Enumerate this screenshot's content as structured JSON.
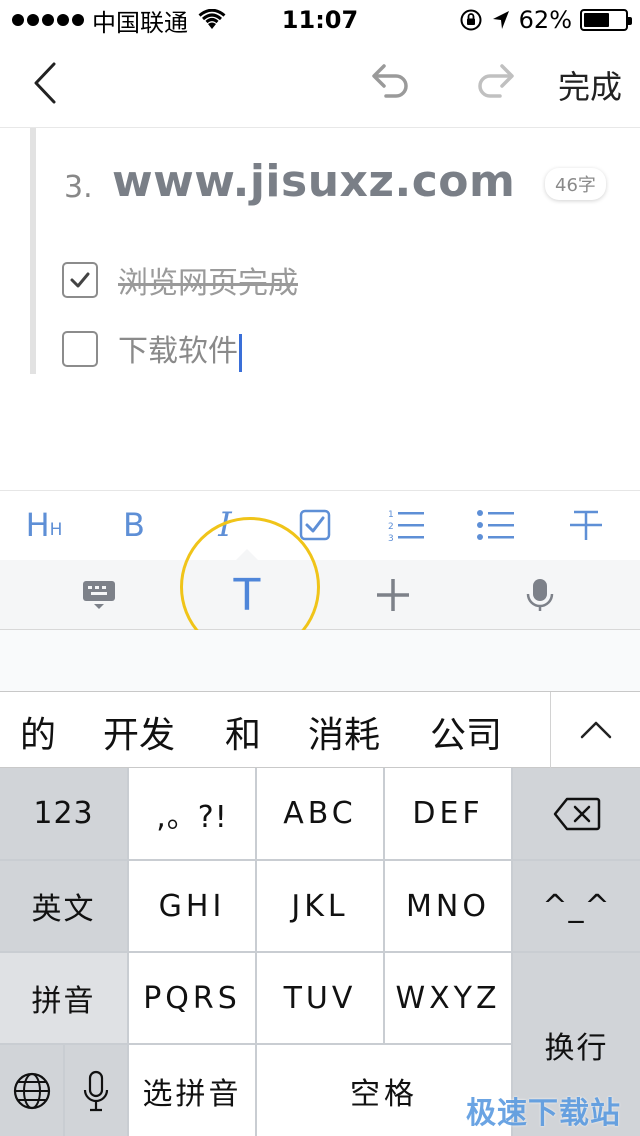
{
  "status_bar": {
    "carrier": "中国联通",
    "time": "11:07",
    "battery_percent": "62%",
    "battery_level": 0.62,
    "icons": [
      "signal-dots-icon",
      "wifi-icon",
      "orientation-lock-icon",
      "location-arrow-icon",
      "battery-icon"
    ]
  },
  "nav": {
    "back_icon": "chevron-left-icon",
    "undo_icon": "undo-arrow-icon",
    "redo_icon": "redo-arrow-icon",
    "done_label": "完成"
  },
  "editor": {
    "heading_number": "3.",
    "heading_text": "www.jisuxz.com",
    "word_count": "46字",
    "todos": [
      {
        "text": "浏览网页完成",
        "checked": true
      },
      {
        "text": "下载软件",
        "checked": false
      }
    ]
  },
  "format_toolbar": {
    "heading_label": "H",
    "heading_sub": "H",
    "bold_label": "B",
    "italic_label": "I",
    "icons": [
      "heading-icon",
      "bold-icon",
      "italic-icon",
      "checkbox-list-icon",
      "numbered-list-icon",
      "bullet-list-icon",
      "strikethrough-icon"
    ],
    "color": "#5e8fd6"
  },
  "tab_bar": {
    "text_tab_label": "T",
    "icons": [
      "keyboard-hide-icon",
      "text-format-icon",
      "plus-icon",
      "microphone-icon"
    ],
    "active_color": "#4f86d9",
    "highlight_color": "#f0c419"
  },
  "candidates": {
    "items": [
      "的",
      "开发",
      "和",
      "消耗",
      "公司"
    ],
    "expand_icon": "chevron-up-icon"
  },
  "keyboard": {
    "row1": [
      "123",
      ",。?!",
      "ABC",
      "DEF"
    ],
    "row2": [
      "英文",
      "GHI",
      "JKL",
      "MNO",
      "^_^"
    ],
    "row3": [
      "拼音",
      "PQRS",
      "TUV",
      "WXYZ"
    ],
    "row4": {
      "select_pinyin": "选拼音",
      "space": "空格"
    },
    "enter": "换行",
    "icons": [
      "backspace-icon",
      "globe-icon",
      "microphone-icon"
    ]
  },
  "watermark": "极速下载站"
}
